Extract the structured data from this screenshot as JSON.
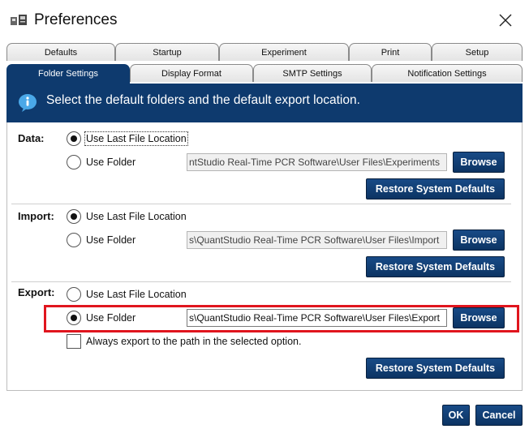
{
  "window": {
    "title": "Preferences",
    "app_icon": "app-windows-icon",
    "close_icon": "close-icon"
  },
  "tabs_row1": [
    "Defaults",
    "Startup",
    "Experiment",
    "Print",
    "Setup"
  ],
  "tabs_row2": [
    "Folder Settings",
    "Display Format",
    "SMTP Settings",
    "Notification Settings"
  ],
  "active_tab": "Folder Settings",
  "banner": {
    "icon": "info-icon",
    "text": "Select the default folders and the default export location."
  },
  "sections": {
    "data": {
      "label": "Data:",
      "option_last": "Use Last File Location",
      "option_folder": "Use Folder",
      "selected": "last",
      "path": "ntStudio Real-Time PCR Software\\User Files\\Experiments",
      "browse": "Browse",
      "restore": "Restore System Defaults"
    },
    "import": {
      "label": "Import:",
      "option_last": "Use Last File Location",
      "option_folder": "Use Folder",
      "selected": "last",
      "path": "s\\QuantStudio Real-Time PCR Software\\User Files\\Import",
      "browse": "Browse",
      "restore": "Restore System Defaults"
    },
    "export": {
      "label": "Export:",
      "option_last": "Use Last File Location",
      "option_folder": "Use Folder",
      "selected": "folder",
      "path": "s\\QuantStudio Real-Time PCR Software\\User Files\\Export",
      "browse": "Browse",
      "always_export": "Always export to the path in the selected option.",
      "always_export_checked": false,
      "restore": "Restore System Defaults"
    }
  },
  "footer": {
    "ok": "OK",
    "cancel": "Cancel"
  },
  "colors": {
    "accent": "#0e3a6e",
    "highlight": "#e0151e"
  }
}
